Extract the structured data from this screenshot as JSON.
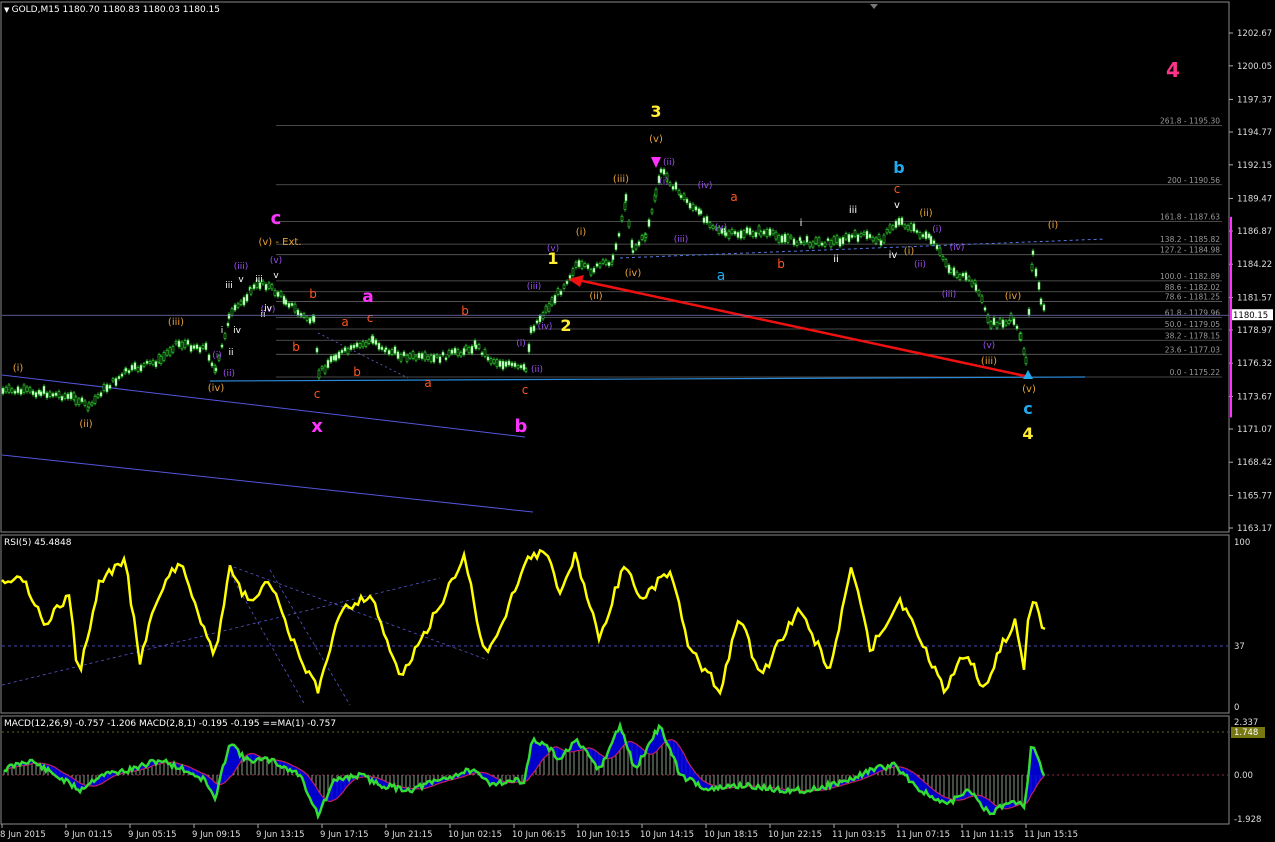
{
  "header": {
    "symbol_line": "GOLD,M15  1180.70 1180.83 1180.03 1180.15"
  },
  "rsi_panel": {
    "title": "RSI(5) 45.4848",
    "levels": [
      "100",
      "37",
      "0"
    ]
  },
  "macd_panel": {
    "title": "MACD(12,26,9) -0.757 -1.206  MACD(2,8,1) -0.195 -0.195  ==MA(1) -0.757",
    "levels": [
      "2.337",
      "0.00",
      "-1.928"
    ],
    "highlight": "1.748"
  },
  "price_axis": {
    "labels": [
      "1202.67",
      "1200.05",
      "1197.37",
      "1194.77",
      "1192.15",
      "1189.47",
      "1186.87",
      "1184.22",
      "1181.57",
      "1178.97",
      "1176.32",
      "1173.67",
      "1171.07",
      "1168.42",
      "1165.77",
      "1163.17"
    ],
    "current": "1180.15"
  },
  "time_axis": [
    "8 Jun 2015",
    "9 Jun 01:15",
    "9 Jun 05:15",
    "9 Jun 09:15",
    "9 Jun 13:15",
    "9 Jun 17:15",
    "9 Jun 21:15",
    "10 Jun 02:15",
    "10 Jun 06:15",
    "10 Jun 10:15",
    "10 Jun 14:15",
    "10 Jun 18:15",
    "10 Jun 22:15",
    "11 Jun 03:15",
    "11 Jun 07:15",
    "11 Jun 11:15",
    "11 Jun 15:15"
  ],
  "fib_levels": [
    "261.8 - 1195.30",
    "200 - 1190.56",
    "161.8 - 1187.63",
    "138.2 - 1185.82",
    "127.2 - 1184.98",
    "100.0 - 1182.89",
    "88.6 - 1182.02",
    "78.6 - 1181.25",
    "61.8 - 1179.96",
    "50.0 - 1179.05",
    "38.2 - 1178.15",
    "23.6 - 1177.03",
    "0.0 - 1175.22"
  ],
  "wave_labels": [
    {
      "t": "(i)",
      "c": "#e8a23a"
    },
    {
      "t": "(ii)",
      "c": "#e8a23a"
    },
    {
      "t": "(iii)",
      "c": "#e8a23a"
    },
    {
      "t": "(iv)",
      "c": "#e8a23a"
    },
    {
      "t": "(i)",
      "c": "#9c4ff0"
    },
    {
      "t": "(ii)",
      "c": "#9c4ff0"
    },
    {
      "t": "iii",
      "c": "#ffffff"
    },
    {
      "t": "i",
      "c": "#ffffff"
    },
    {
      "t": "ii",
      "c": "#ffffff"
    },
    {
      "t": "iv",
      "c": "#ffffff"
    },
    {
      "t": "(iii)",
      "c": "#9c4ff0"
    },
    {
      "t": "v",
      "c": "#ffffff"
    },
    {
      "t": "iii",
      "c": "#ffffff"
    },
    {
      "t": "(iv)",
      "c": "#9c4ff0"
    },
    {
      "t": "iv",
      "c": "#ffffff"
    },
    {
      "t": "ii",
      "c": "#ffffff"
    },
    {
      "t": "v",
      "c": "#ffffff"
    },
    {
      "t": "(v)",
      "c": "#9c4ff0"
    },
    {
      "t": "c",
      "c": "#ff33ff"
    },
    {
      "t": "(v) - Ext.",
      "c": "#e8a23a"
    },
    {
      "t": "b",
      "c": "#ff5522"
    },
    {
      "t": "b",
      "c": "#ff5522"
    },
    {
      "t": "c",
      "c": "#ff5522"
    },
    {
      "t": "x",
      "c": "#ff33ff"
    },
    {
      "t": "a",
      "c": "#ff33ff"
    },
    {
      "t": "a",
      "c": "#ff5522"
    },
    {
      "t": "c",
      "c": "#ff5522"
    },
    {
      "t": "b",
      "c": "#ff5522"
    },
    {
      "t": "a",
      "c": "#ff5522"
    },
    {
      "t": "b",
      "c": "#ff5522"
    },
    {
      "t": "b",
      "c": "#ff33ff"
    },
    {
      "t": "c",
      "c": "#ff5522"
    },
    {
      "t": "(ii)",
      "c": "#9c4ff0"
    },
    {
      "t": "(i)",
      "c": "#9c4ff0"
    },
    {
      "t": "(iii)",
      "c": "#9c4ff0"
    },
    {
      "t": "(iv)",
      "c": "#9c4ff0"
    },
    {
      "t": "(v)",
      "c": "#9c4ff0"
    },
    {
      "t": "1",
      "c": "#ffee33"
    },
    {
      "t": "2",
      "c": "#ffee33"
    },
    {
      "t": "(i)",
      "c": "#e8a23a"
    },
    {
      "t": "(ii)",
      "c": "#e8a23a"
    },
    {
      "t": "(iii)",
      "c": "#e8a23a"
    },
    {
      "t": "(iv)",
      "c": "#e8a23a"
    },
    {
      "t": "3",
      "c": "#ffee33"
    },
    {
      "t": "(v)",
      "c": "#e8a23a"
    },
    {
      "t": "(ii)",
      "c": "#9c4ff0"
    },
    {
      "t": "(i)",
      "c": "#9c4ff0"
    },
    {
      "t": "(iv)",
      "c": "#9c4ff0"
    },
    {
      "t": "(iii)",
      "c": "#9c4ff0"
    },
    {
      "t": "(v)",
      "c": "#9c4ff0"
    },
    {
      "t": "a",
      "c": "#ff5522"
    },
    {
      "t": "a",
      "c": "#22aaee"
    },
    {
      "t": "b",
      "c": "#ff5522"
    },
    {
      "t": "i",
      "c": "#ffffff"
    },
    {
      "t": "ii",
      "c": "#ffffff"
    },
    {
      "t": "iii",
      "c": "#ffffff"
    },
    {
      "t": "iv",
      "c": "#ffffff"
    },
    {
      "t": "b",
      "c": "#22aaee"
    },
    {
      "t": "c",
      "c": "#ff5522"
    },
    {
      "t": "v",
      "c": "#ffffff"
    },
    {
      "t": "(ii)",
      "c": "#e8a23a"
    },
    {
      "t": "(i)",
      "c": "#e8a23a"
    },
    {
      "t": "(i)",
      "c": "#9c4ff0"
    },
    {
      "t": "(ii)",
      "c": "#9c4ff0"
    },
    {
      "t": "(iv)",
      "c": "#9c4ff0"
    },
    {
      "t": "(iii)",
      "c": "#9c4ff0"
    },
    {
      "t": "(iv)",
      "c": "#e8a23a"
    },
    {
      "t": "(v)",
      "c": "#9c4ff0"
    },
    {
      "t": "(iii)",
      "c": "#e8a23a"
    },
    {
      "t": "(v)",
      "c": "#e8a23a"
    },
    {
      "t": "c",
      "c": "#22aaee"
    },
    {
      "t": "4",
      "c": "#ffee33"
    },
    {
      "t": "(i)",
      "c": "#e8a23a"
    },
    {
      "t": "4",
      "c": "#ff3388"
    }
  ],
  "colors": {
    "candle": "#33dd33",
    "rsi": "#ffff00",
    "macd_line": "#33dd33",
    "macd_fill": "#0000ee",
    "signal": "#c02060",
    "arrow": "#ee1111",
    "grid": "#3a3a55",
    "fib": "#606060"
  }
}
